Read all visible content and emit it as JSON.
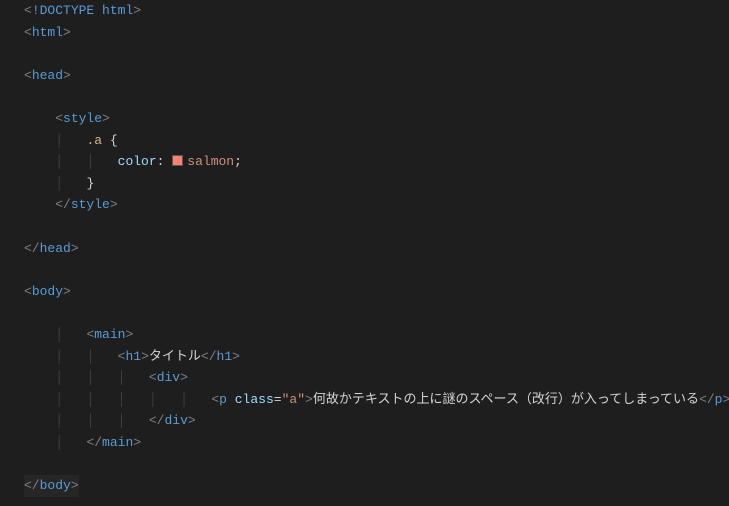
{
  "code": {
    "doctype_bang": "!",
    "doctype_kw": "DOCTYPE",
    "doctype_html": "html",
    "tag_html": "html",
    "tag_head": "head",
    "tag_style": "style",
    "css_selector": ".a",
    "css_open_brace": "{",
    "css_prop": "color",
    "css_colon": ":",
    "css_value": "salmon",
    "css_semicolon": ";",
    "css_close_brace": "}",
    "tag_body": "body",
    "tag_main": "main",
    "tag_h1": "h1",
    "h1_text": "タイトル",
    "tag_div": "div",
    "tag_p": "p",
    "attr_class": "class",
    "attr_eq": "=",
    "attr_quote": "\"",
    "attr_value": "a",
    "p_text": "何故かテキストの上に謎のスペース（改行）が入ってしまっている"
  },
  "color_swatch": "#fa8072"
}
